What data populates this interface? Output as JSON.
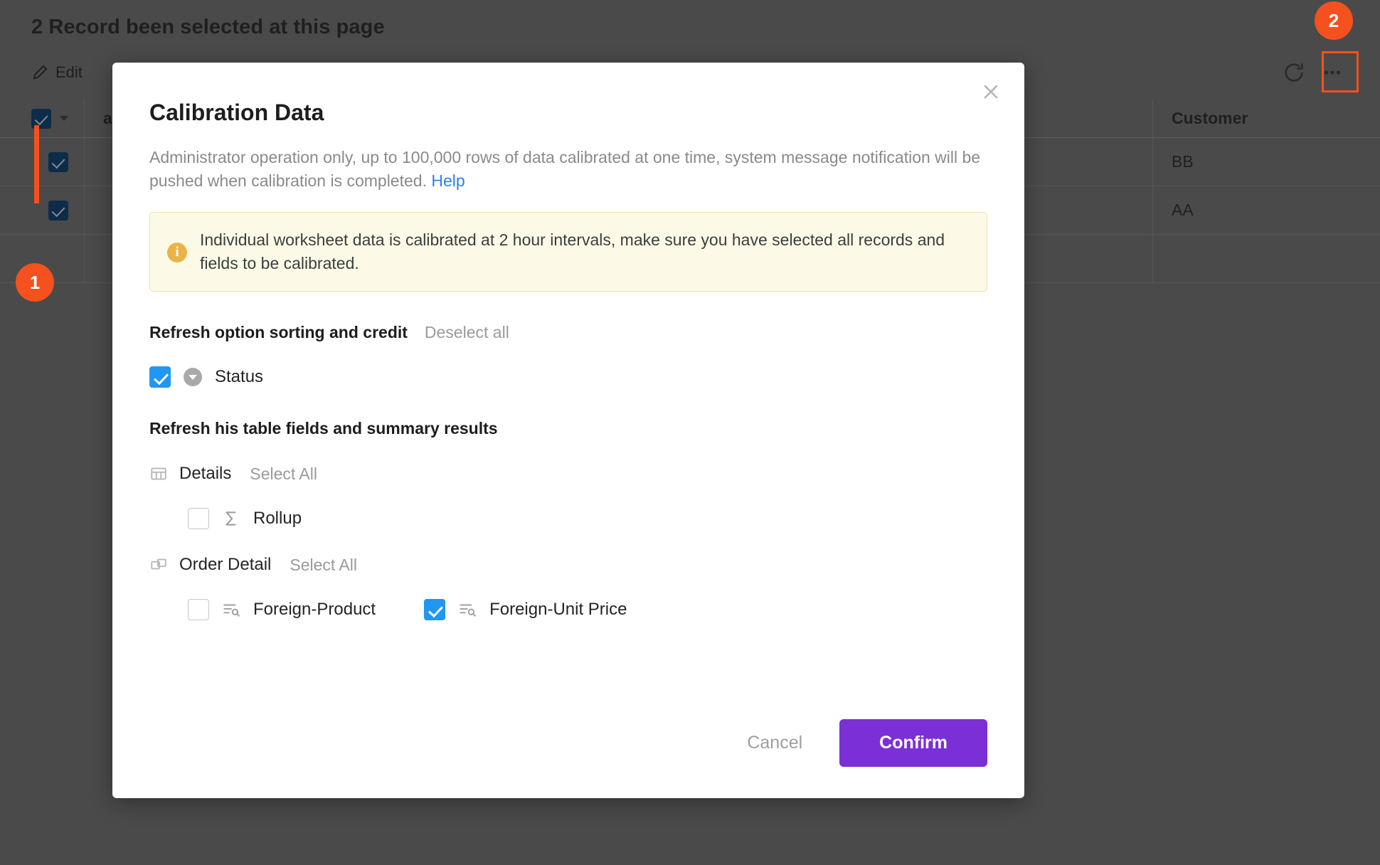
{
  "background": {
    "selection_banner": "2 Record been selected at this page",
    "toolbar": {
      "edit_label": "Edit",
      "icons": [
        "pencil-icon",
        "copy-icon",
        "export-icon",
        "print-icon",
        "delete-icon"
      ]
    },
    "toolbar_right": {
      "refresh_icon": "refresh-icon",
      "more_icon": "more-horizontal-icon"
    },
    "table": {
      "columns": [
        "",
        "ature",
        "Customer"
      ],
      "rows": [
        {
          "checked": true,
          "customer": "BB"
        },
        {
          "checked": true,
          "customer": "AA"
        }
      ]
    },
    "annotations": [
      {
        "label": "1"
      },
      {
        "label": "2"
      }
    ]
  },
  "modal": {
    "title": "Calibration Data",
    "close_icon": "close-icon",
    "description": "Administrator operation only, up to 100,000 rows of data calibrated at one time, system message notification will be pushed when calibration is completed.",
    "help_link": "Help",
    "info": {
      "icon": "info-icon",
      "text": "Individual worksheet data is calibrated at 2 hour intervals, make sure you have selected all records and fields to be calibrated."
    },
    "section_options": {
      "title": "Refresh option sorting and credit",
      "action": "Deselect all",
      "items": [
        {
          "label": "Status",
          "checked": true,
          "icon": "dropdown-field-icon"
        }
      ]
    },
    "section_fields": {
      "title": "Refresh his table fields and summary results",
      "groups": [
        {
          "name": "Details",
          "icon": "table-grid-icon",
          "action": "Select All",
          "fields": [
            {
              "label": "Rollup",
              "checked": false,
              "icon": "sigma-rollup-icon"
            }
          ]
        },
        {
          "name": "Order Detail",
          "icon": "related-records-icon",
          "action": "Select All",
          "fields": [
            {
              "label": "Foreign-Product",
              "checked": false,
              "icon": "lookup-field-icon"
            },
            {
              "label": "Foreign-Unit Price",
              "checked": true,
              "icon": "lookup-field-icon"
            }
          ]
        }
      ]
    },
    "footer": {
      "cancel_label": "Cancel",
      "confirm_label": "Confirm"
    }
  },
  "colors": {
    "accent_purple": "#7b2fd6",
    "checkbox_blue": "#2196f3",
    "link_blue": "#2f80ed",
    "marker_orange": "#f4511e",
    "info_bg": "#fcfae7"
  }
}
